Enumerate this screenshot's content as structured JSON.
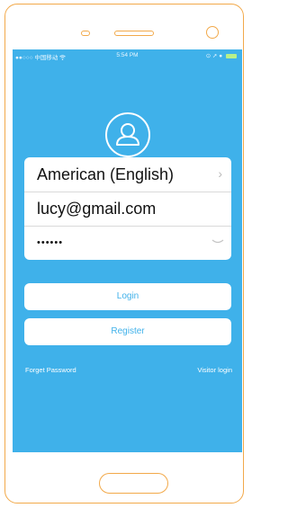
{
  "status_bar": {
    "carrier": "●●○○○ 中国移动 ",
    "time": "5:54 PM",
    "indicators": "⊙ ➚ ●"
  },
  "login_card": {
    "language": "American (English)",
    "email": "lucy@gmail.com",
    "password_mask": "••••••"
  },
  "buttons": {
    "login": "Login",
    "register": "Register"
  },
  "links": {
    "forgot_password": "Forget Password",
    "visitor_login": "Visitor login"
  },
  "colors": {
    "screen_bg": "#3fb1ea",
    "device_outline": "#f2a94a",
    "button_text": "#3fb1ea"
  },
  "icons": [
    "user-avatar-icon",
    "chevron-right-icon",
    "eye-icon",
    "wifi-icon",
    "battery-icon"
  ]
}
